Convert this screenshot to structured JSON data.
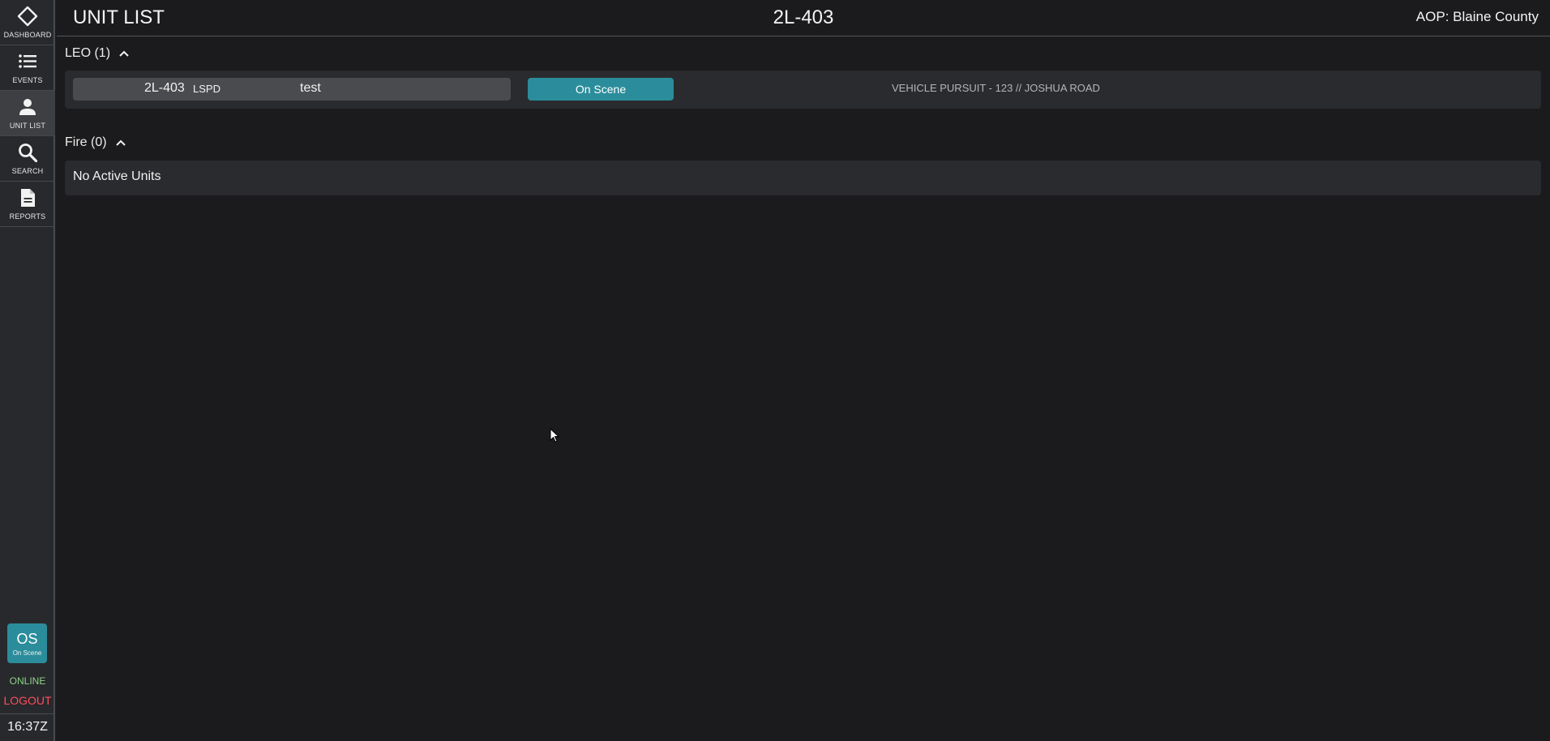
{
  "sidebar": {
    "items": [
      {
        "label": "DASHBOARD",
        "icon": "diamond-icon"
      },
      {
        "label": "EVENTS",
        "icon": "list-icon"
      },
      {
        "label": "UNIT LIST",
        "icon": "person-icon",
        "active": true
      },
      {
        "label": "SEARCH",
        "icon": "search-icon"
      },
      {
        "label": "REPORTS",
        "icon": "document-icon"
      }
    ],
    "status": {
      "code": "OS",
      "label": "On Scene",
      "color": "#2b8d9b"
    },
    "connection": "ONLINE",
    "logout": "LOGOUT",
    "clock": "16:37Z"
  },
  "header": {
    "title": "UNIT LIST",
    "callsign": "2L-403",
    "aop": "AOP: Blaine County"
  },
  "sections": {
    "leo": {
      "title": "LEO (1)",
      "units": [
        {
          "callsign": "2L-403",
          "agency": "LSPD",
          "name": "test",
          "status": "On Scene",
          "call": "VEHICLE PURSUIT - 123 // JOSHUA ROAD"
        }
      ]
    },
    "fire": {
      "title": "Fire (0)",
      "empty": "No Active Units"
    }
  },
  "colors": {
    "background": "#1b1b1d",
    "sidebar": "#28292c",
    "panel": "#2a2b2e",
    "accent": "#2b8d9b",
    "online": "#8cd48a",
    "logout": "#ff4d5e"
  }
}
